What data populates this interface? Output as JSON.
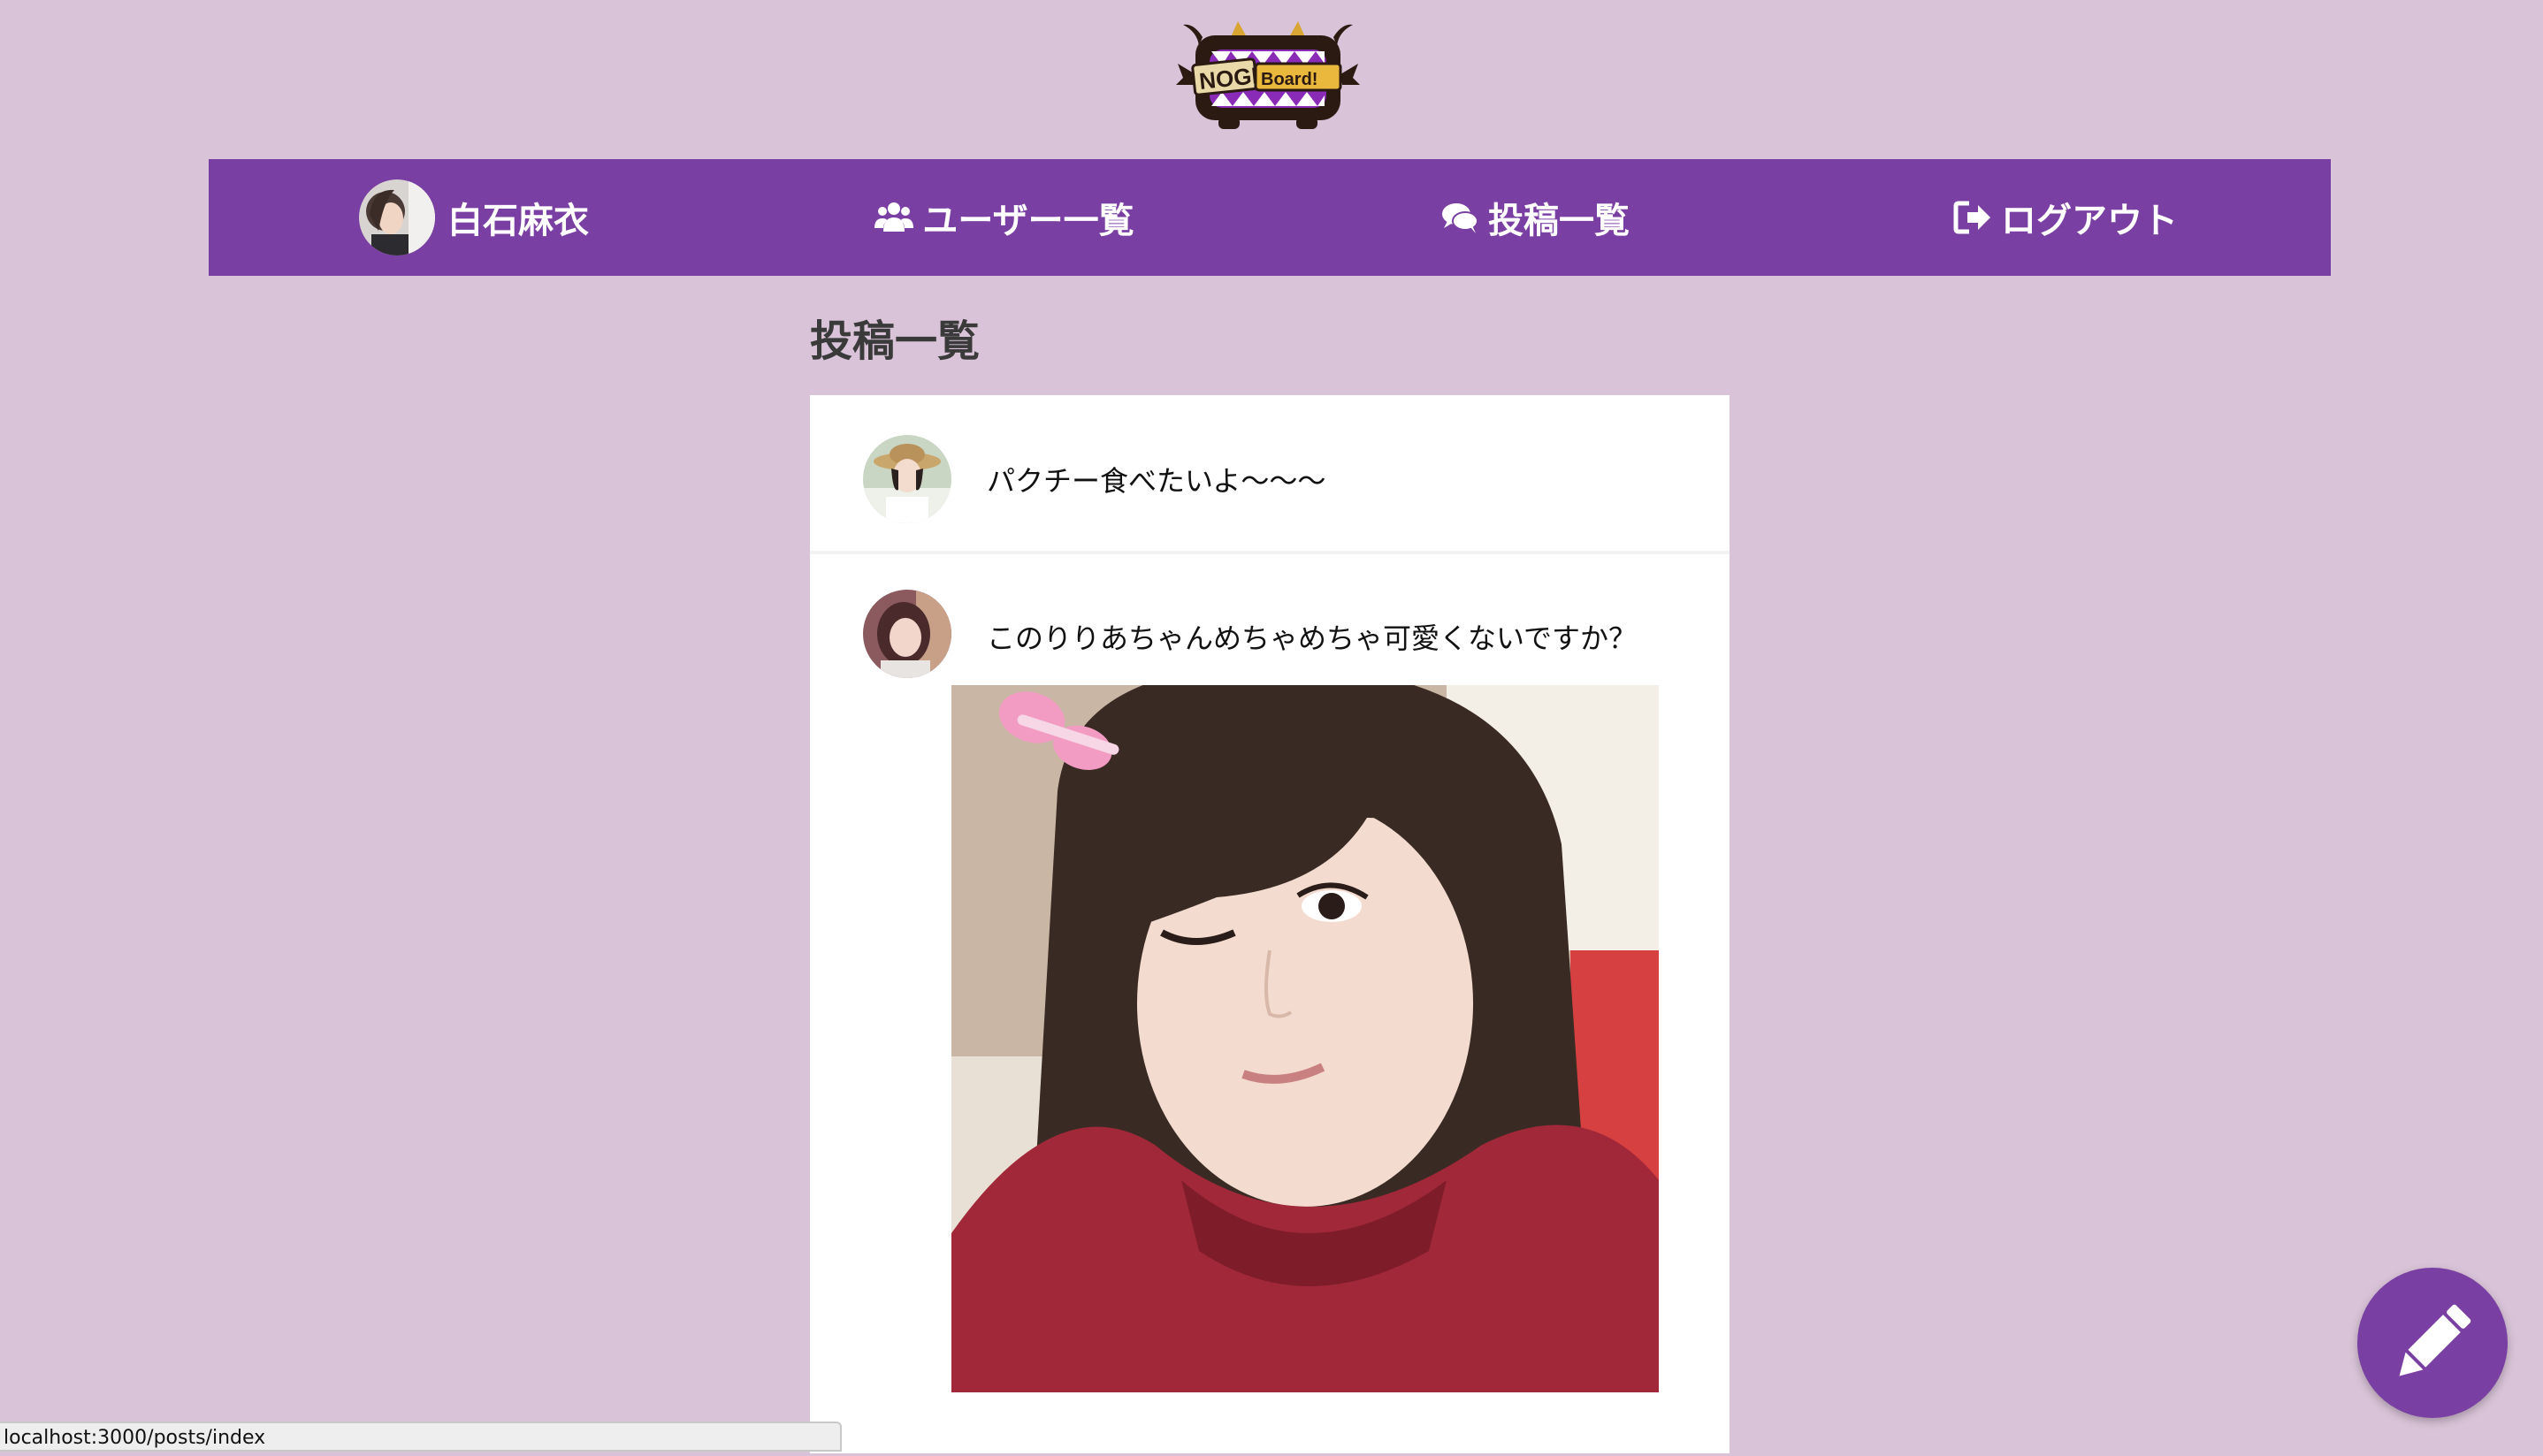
{
  "logo": {
    "text_left": "NOGI",
    "text_right": "Board!",
    "icon": "monster-logo-icon"
  },
  "nav": {
    "user": {
      "name": "白石麻衣",
      "icon": "user-avatar"
    },
    "users": {
      "label": "ユーザー一覧",
      "icon": "users-icon"
    },
    "posts": {
      "label": "投稿一覧",
      "icon": "comments-icon"
    },
    "logout": {
      "label": "ログアウト",
      "icon": "sign-out-icon"
    }
  },
  "page": {
    "title": "投稿一覧"
  },
  "posts": [
    {
      "text": "パクチー食べたいよ〜〜〜",
      "avatar": "user-avatar"
    },
    {
      "text": "このりりあちゃんめちゃめちゃ可愛くないですか？",
      "avatar": "user-avatar",
      "image": "post-photo"
    }
  ],
  "fab": {
    "icon": "pencil-icon"
  },
  "status_bar": {
    "url": "localhost:3000/posts/index"
  },
  "colors": {
    "background": "#d9c3d8",
    "accent": "#7a3fa3",
    "panel": "#ffffff"
  }
}
